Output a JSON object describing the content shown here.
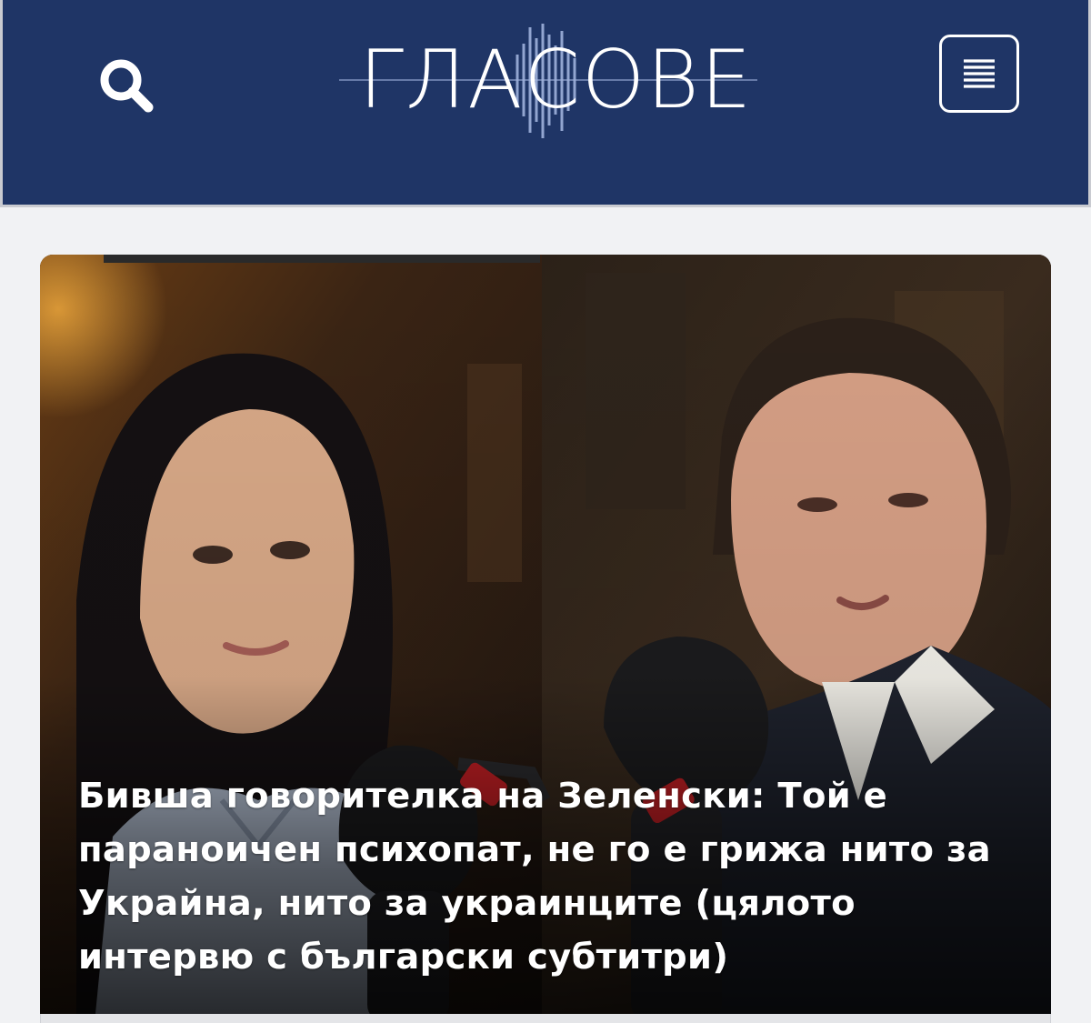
{
  "header": {
    "logo_text": "ГЛАСОВЕ",
    "search_icon": "search-icon",
    "menu_icon": "hamburger-menu-icon",
    "background_color": "#1f3566"
  },
  "article": {
    "headline": "Бивша говорителка на Зеленски: Той е параноичен психопат, не го е грижа нито за Украйна, нито за украинците (цялото интервю с български субтитри)",
    "image_description_icon": "article-photo"
  }
}
